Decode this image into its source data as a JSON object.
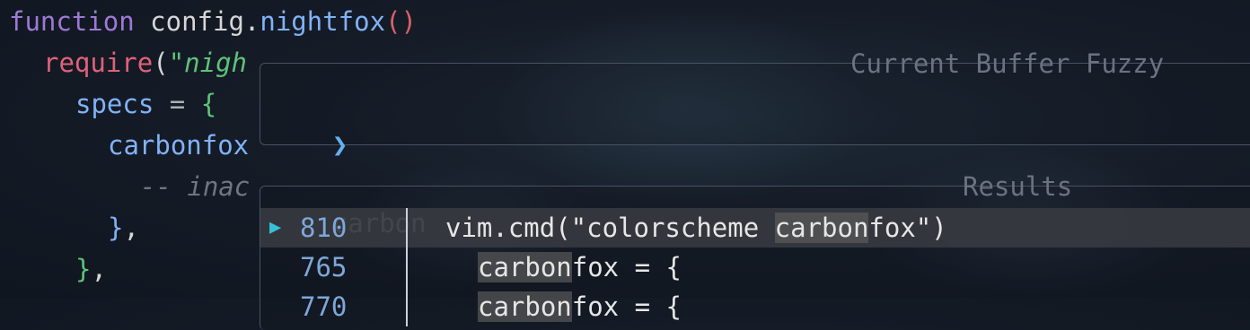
{
  "editor": {
    "lines": [
      {
        "indent": "",
        "tokens": [
          {
            "t": "function",
            "c": "kw"
          },
          {
            "t": " ",
            "c": "plain"
          },
          {
            "t": "config.",
            "c": "plain"
          },
          {
            "t": "nightfox",
            "c": "fn"
          },
          {
            "t": "()",
            "c": "paren"
          }
        ]
      },
      {
        "indent": " ",
        "tokens": [
          {
            "t": "require",
            "c": "req"
          },
          {
            "t": "(",
            "c": "plain"
          },
          {
            "t": "\"nigh",
            "c": "str"
          }
        ]
      },
      {
        "indent": "   ",
        "tokens": [
          {
            "t": "specs",
            "c": "field"
          },
          {
            "t": " = ",
            "c": "op"
          },
          {
            "t": "{",
            "c": "brace"
          }
        ]
      },
      {
        "indent": "   ",
        "tokens": [
          {
            "t": "carbonfox",
            "c": "field"
          }
        ]
      },
      {
        "indent": "     ",
        "tokens": [
          {
            "t": "-- inac",
            "c": "comment"
          }
        ]
      },
      {
        "indent": "   ",
        "tokens": [
          {
            "t": "}",
            "c": "brace2"
          },
          {
            "t": ",",
            "c": "plain"
          }
        ]
      },
      {
        "indent": "  ",
        "tokens": [
          {
            "t": "}",
            "c": "brace"
          },
          {
            "t": ",",
            "c": "plain"
          }
        ]
      }
    ]
  },
  "prompt_panel": {
    "title": "Current Buffer Fuzzy",
    "caret": "❯",
    "query": "carbon"
  },
  "results_panel": {
    "title": "Results",
    "selected_marker": "▶",
    "rows": [
      {
        "line": "810",
        "pre": "vim.cmd(\"colorscheme ",
        "match": "carbon",
        "post": "fox\")",
        "indent": 0,
        "selected": true
      },
      {
        "line": "765",
        "pre": "",
        "match": "carbon",
        "post": "fox = {",
        "indent": 1,
        "selected": false
      },
      {
        "line": "770",
        "pre": "",
        "match": "carbon",
        "post": "fox = {",
        "indent": 1,
        "selected": false
      }
    ]
  }
}
